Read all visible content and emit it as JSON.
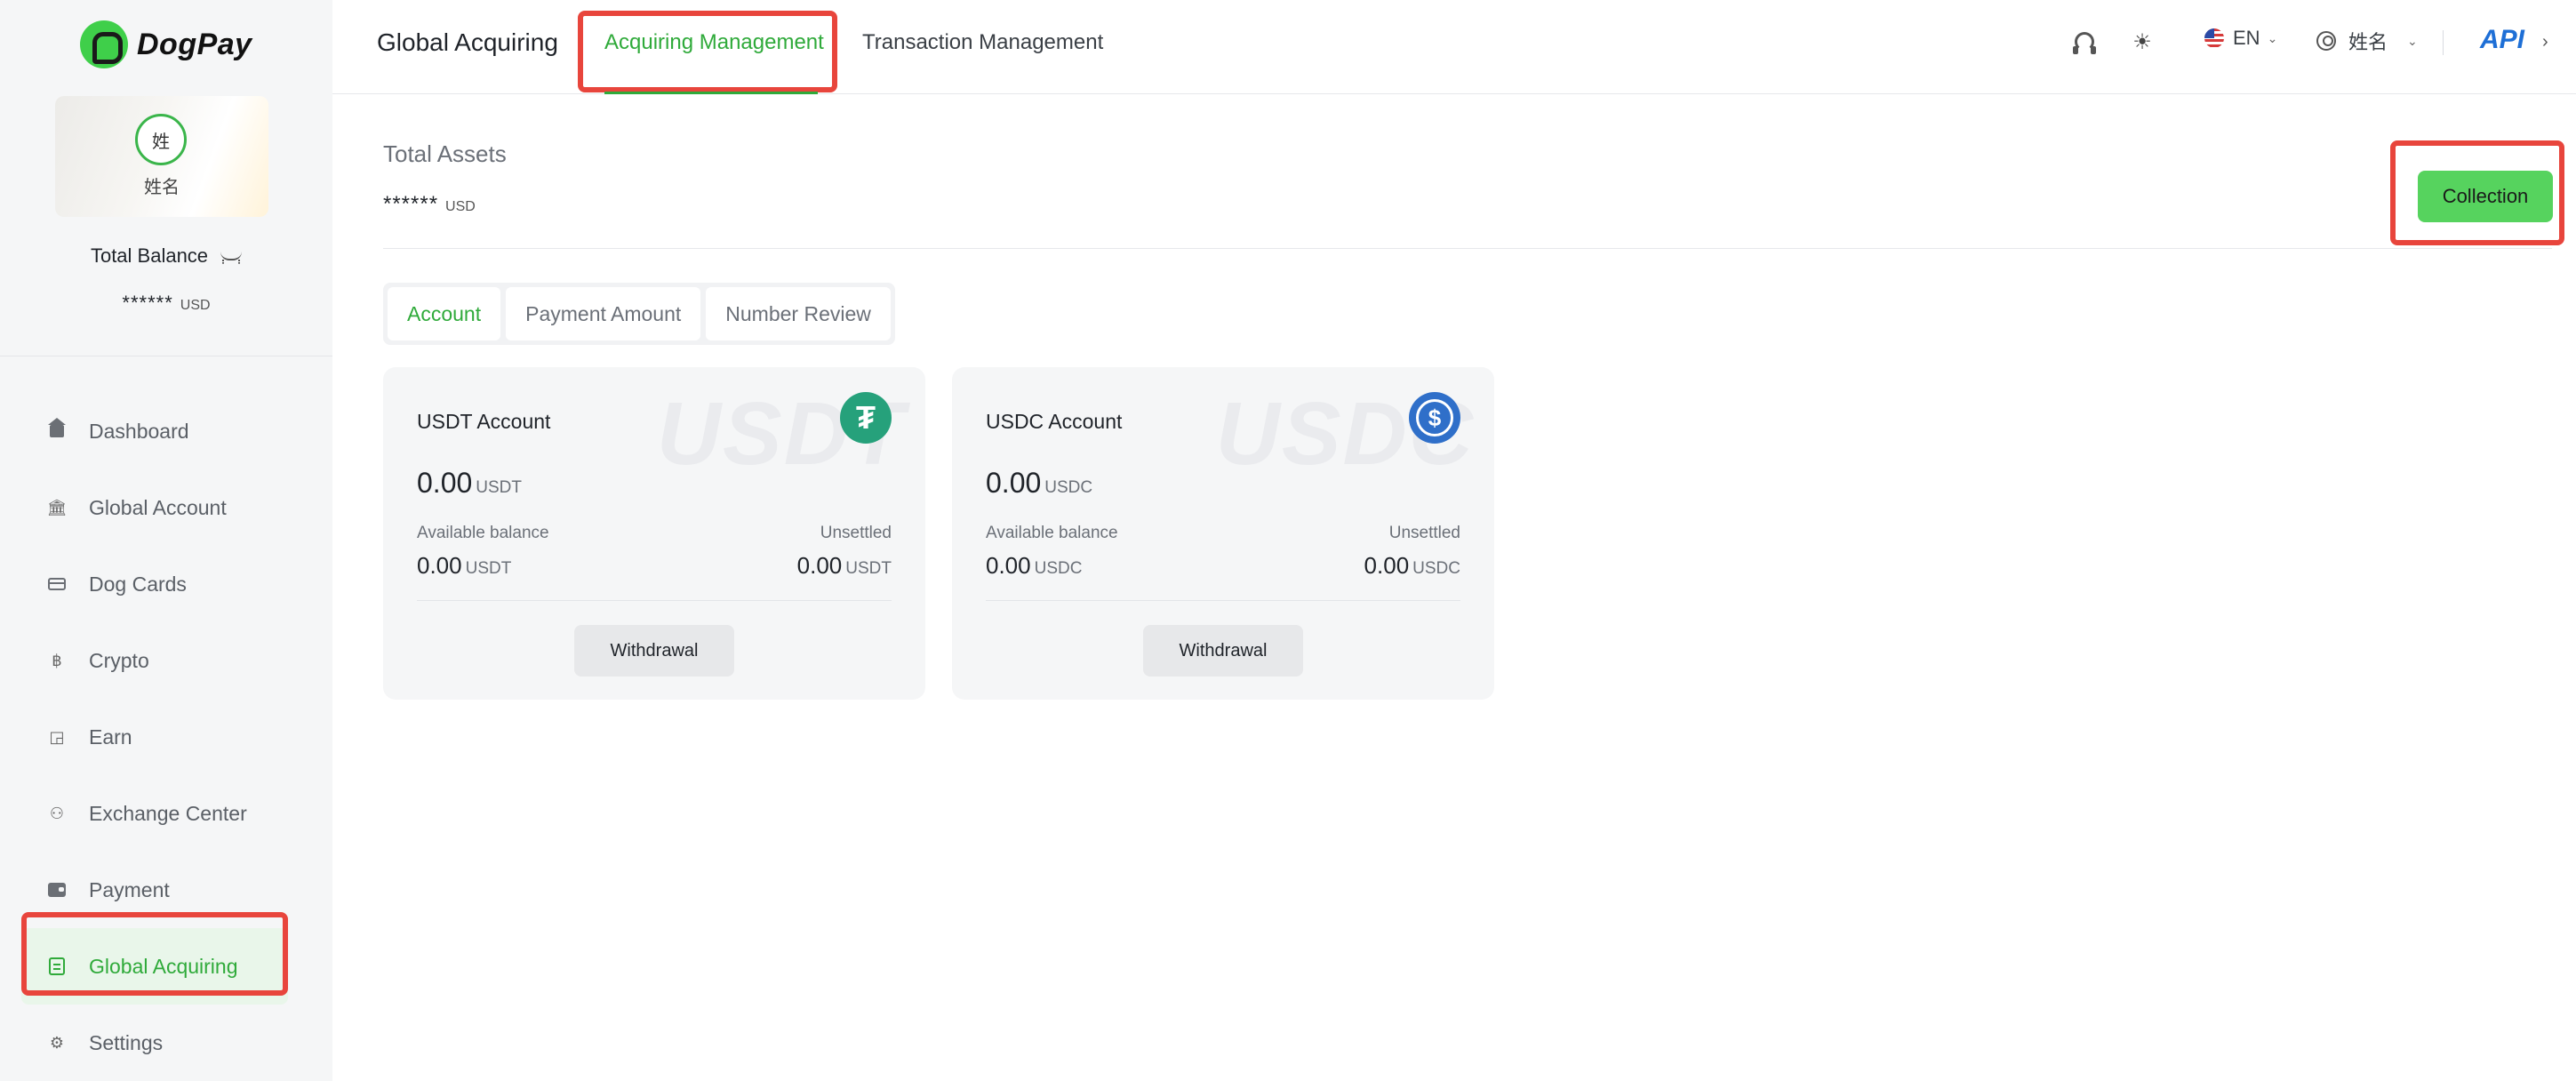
{
  "app": {
    "logo_text": "DogPay"
  },
  "profile": {
    "avatar_initial": "姓",
    "name": "姓名"
  },
  "sidebar": {
    "balance_label": "Total Balance",
    "balance_value": "******",
    "balance_unit": "USD",
    "items": [
      {
        "label": "Dashboard",
        "icon": "home-icon"
      },
      {
        "label": "Global Account",
        "icon": "bank-icon"
      },
      {
        "label": "Dog Cards",
        "icon": "card-icon"
      },
      {
        "label": "Crypto",
        "icon": "bitcoin-icon"
      },
      {
        "label": "Earn",
        "icon": "earn-icon"
      },
      {
        "label": "Exchange Center",
        "icon": "exchange-icon"
      },
      {
        "label": "Payment",
        "icon": "wallet-icon"
      },
      {
        "label": "Global Acquiring",
        "icon": "acquiring-icon",
        "active": true
      },
      {
        "label": "Settings",
        "icon": "gear-icon"
      }
    ]
  },
  "header": {
    "title": "Global Acquiring",
    "tabs": [
      {
        "label": "Acquiring Management",
        "active": true
      },
      {
        "label": "Transaction Management",
        "active": false
      }
    ],
    "language": "EN",
    "user_name": "姓名",
    "api_label": "API"
  },
  "main": {
    "assets_title": "Total Assets",
    "assets_value": "******",
    "assets_unit": "USD",
    "collection_button": "Collection",
    "sub_tabs": [
      {
        "label": "Account",
        "active": true
      },
      {
        "label": "Payment Amount",
        "active": false
      },
      {
        "label": "Number Review",
        "active": false
      }
    ],
    "accounts": [
      {
        "name": "USDT Account",
        "watermark": "USDT",
        "total": "0.00",
        "unit": "USDT",
        "available_label": "Available balance",
        "available_value": "0.00",
        "unsettled_label": "Unsettled",
        "unsettled_value": "0.00",
        "withdraw_label": "Withdrawal",
        "coin_icon": "tether-icon",
        "coin_color": "#26a17b"
      },
      {
        "name": "USDC Account",
        "watermark": "USDC",
        "total": "0.00",
        "unit": "USDC",
        "available_label": "Available balance",
        "available_value": "0.00",
        "unsettled_label": "Unsettled",
        "unsettled_value": "0.00",
        "withdraw_label": "Withdrawal",
        "coin_icon": "usd-coin-icon",
        "coin_color": "#2f6fc9"
      }
    ]
  },
  "colors": {
    "accent": "#2faa3a",
    "collection_button": "#56d35e",
    "highlight": "#e8453c",
    "api": "#1e6fd6"
  }
}
